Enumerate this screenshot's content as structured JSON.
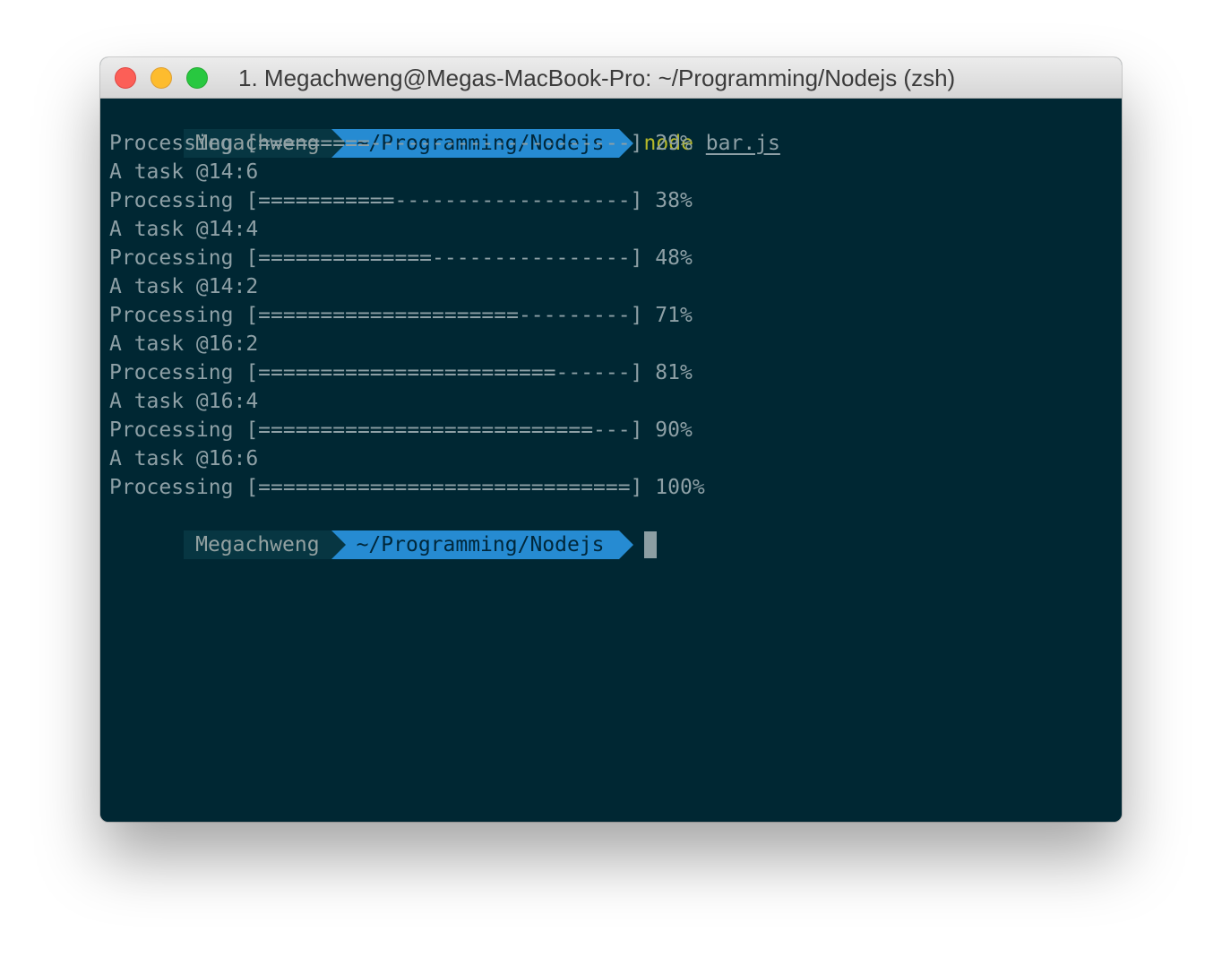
{
  "window": {
    "title": "1. Megachweng@Megas-MacBook-Pro: ~/Programming/Nodejs (zsh)"
  },
  "colors": {
    "terminal_bg": "#002733",
    "prompt_user_bg": "#073642",
    "prompt_path_bg": "#268bd2",
    "command": "#b5b82a",
    "text": "#8ea0a6"
  },
  "prompt": {
    "user": "Megachweng",
    "path": "~/Programming/Nodejs"
  },
  "command": {
    "name": "node",
    "arg": "bar.js"
  },
  "output": [
    "Processing [=========---------------------] 29%",
    "A task @14:6",
    "Processing [===========-------------------] 38%",
    "A task @14:4",
    "Processing [==============----------------] 48%",
    "A task @14:2",
    "Processing [=====================---------] 71%",
    "A task @16:2",
    "Processing [========================------] 81%",
    "A task @16:4",
    "Processing [===========================---] 90%",
    "A task @16:6",
    "Processing [==============================] 100%"
  ]
}
